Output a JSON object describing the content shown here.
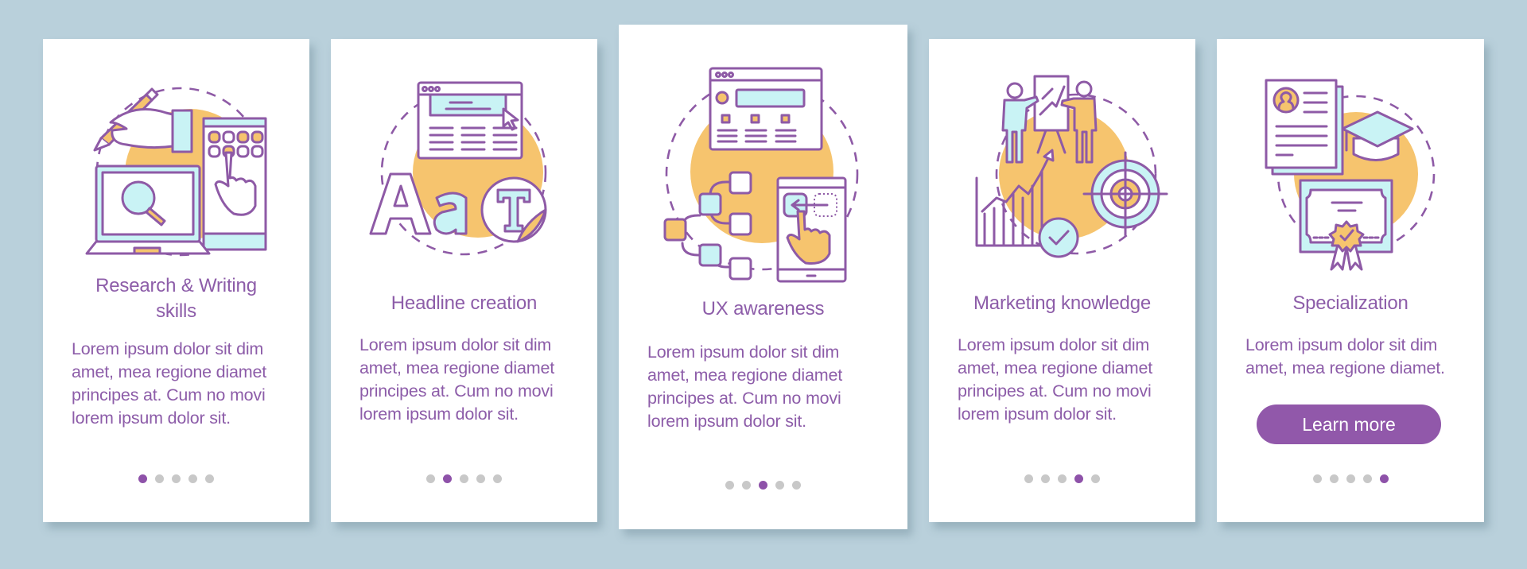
{
  "colors": {
    "background": "#b9d0db",
    "card": "#ffffff",
    "text_purple": "#8d5da9",
    "accent_purple": "#9158aa",
    "illustration_orange": "#f6c46e",
    "illustration_cyan": "#c9f3f5",
    "dot_inactive": "#c8c8c8"
  },
  "screens": [
    {
      "title_lines": [
        "Research & Writing",
        "skills"
      ],
      "icon": "research-writing-icon",
      "body_lines": [
        "Lorem ipsum dolor sit dim",
        "amet, mea regione diamet",
        "principes at. Cum no movi",
        "lorem ipsum dolor sit."
      ],
      "page_index": 1,
      "page_count": 5
    },
    {
      "title_lines": [
        "Headline creation"
      ],
      "icon": "headline-creation-icon",
      "body_lines": [
        "Lorem ipsum dolor sit dim",
        "amet, mea regione diamet",
        "principes at. Cum no movi",
        "lorem ipsum dolor sit."
      ],
      "page_index": 2,
      "page_count": 5
    },
    {
      "title_lines": [
        "UX awareness"
      ],
      "icon": "ux-awareness-icon",
      "body_lines": [
        "Lorem ipsum dolor sit dim",
        "amet, mea regione diamet",
        "principes at. Cum no movi",
        "lorem ipsum dolor sit."
      ],
      "page_index": 3,
      "page_count": 5
    },
    {
      "title_lines": [
        "Marketing knowledge"
      ],
      "icon": "marketing-knowledge-icon",
      "body_lines": [
        "Lorem ipsum dolor sit dim",
        "amet, mea regione diamet",
        "principes at. Cum no movi",
        "lorem ipsum dolor sit."
      ],
      "page_index": 4,
      "page_count": 5
    },
    {
      "title_lines": [
        "Specialization"
      ],
      "icon": "specialization-icon",
      "body_lines": [
        "Lorem ipsum dolor sit dim",
        "amet, mea regione diamet."
      ],
      "button_label": "Learn more",
      "page_index": 5,
      "page_count": 5
    }
  ]
}
